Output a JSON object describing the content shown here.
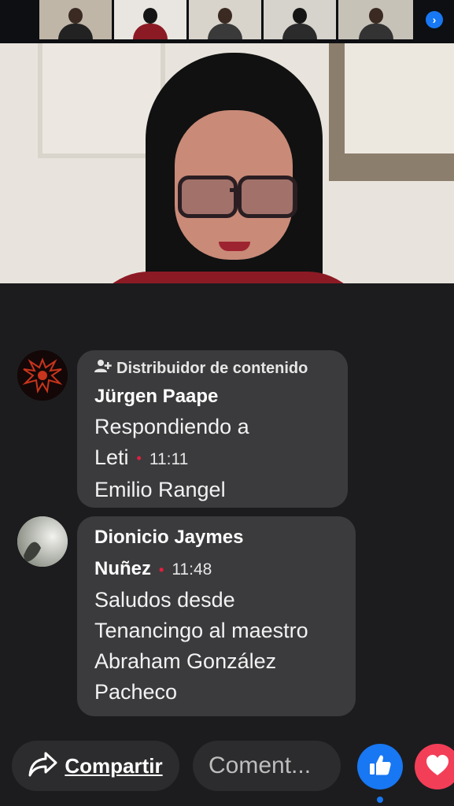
{
  "participants": [
    {
      "name": "participant-1",
      "bg": "#bfb6a8",
      "shirt": "#222"
    },
    {
      "name": "participant-2",
      "bg": "#e9e6e1",
      "shirt": "#8c1a24"
    },
    {
      "name": "participant-3",
      "bg": "#d8d3cb",
      "shirt": "#3a3a3a"
    },
    {
      "name": "participant-4",
      "bg": "#d6d2cc",
      "shirt": "#2b2b2b"
    },
    {
      "name": "participant-5",
      "bg": "#c7c2b8",
      "shirt": "#333"
    }
  ],
  "comments": [
    {
      "badge": "Distribuidor de contenido",
      "badge_icon": "person-plus-icon",
      "author": "Jürgen Paape",
      "reply_line": "Respondiendo a",
      "reply_to": "Leti",
      "time": "11:11",
      "message": "Emilio Rangel"
    },
    {
      "author_line1": "Dionicio Jaymes",
      "author_line2": "Nuñez",
      "time": "11:48",
      "message_lines": [
        "Saludos desde",
        "Tenancingo al maestro",
        "Abraham González",
        "Pacheco"
      ]
    }
  ],
  "actions": {
    "share_label": "Compartir",
    "share_icon": "share-arrow-icon",
    "comment_placeholder": "Coment...",
    "like_icon": "thumbs-up-icon",
    "love_icon": "heart-icon"
  },
  "colors": {
    "accent": "#1877f2",
    "love": "#f33e58",
    "dot": "#e41e3f",
    "bubble": "#3b3b3d"
  }
}
